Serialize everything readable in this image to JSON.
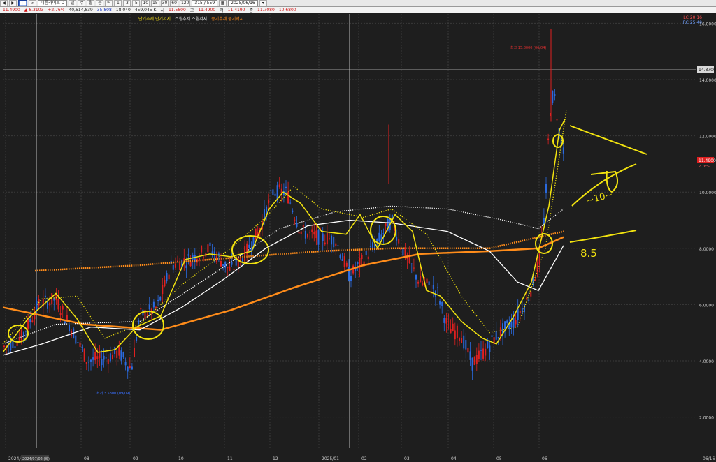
{
  "toolbar": {
    "symbol": "이룸라이트 D",
    "ratio": "315 / 559",
    "date": "2025/06/16",
    "periods": [
      "일",
      "주",
      "월",
      "분",
      "틱",
      "1",
      "3",
      "5",
      "10",
      "15",
      "30",
      "60",
      "120"
    ]
  },
  "quote": {
    "price": "11.4900",
    "change": "▲ 8.3103",
    "change_pct": "+2.76%",
    "volume": "40,614,839",
    "ratio1": "35.808",
    "ratio2": "18.040",
    "amount": "459,045 K",
    "open_label": "시",
    "open": "11.5800",
    "high_label": "고",
    "high": "11.4900",
    "low_label": "저",
    "low": "11.4190",
    "close_label": "종",
    "close": "11.7080",
    "last": "10.6800"
  },
  "legend": [
    {
      "text": "단기추세  단기저지",
      "color": "#e6d21a"
    },
    {
      "text": "스윙추세  스윙저지",
      "color": "#e0e0e0"
    },
    {
      "text": "중기추세  중기저지",
      "color": "#ff8a1a"
    }
  ],
  "corner": {
    "line1": "LC:20.16",
    "line2": "RC:25.40"
  },
  "axis": {
    "y_ticks": [
      "16.0000",
      "14.0000",
      "12.0000",
      "10.0000",
      "8.0000",
      "6.0000",
      "4.0000",
      "2.0000"
    ],
    "y_values": [
      16,
      14,
      12,
      10,
      8,
      6,
      4,
      2
    ],
    "x_ticks": [
      "2024/06",
      "08",
      "09",
      "10",
      "11",
      "12",
      "2025/01",
      "02",
      "03",
      "04",
      "05",
      "06",
      "06/16"
    ],
    "ref_price_label": "14.8700",
    "current_price_label": "11.4900",
    "current_pct_label": "2.76%",
    "peak_label": "최고 15.8000 (06/04)",
    "low_label": "최저 3.5300 (09/09)",
    "cursor_date": "2024/07/02 (화)"
  },
  "colors": {
    "bg": "#1e1e1e",
    "grid": "#3a3a3a",
    "up": "#e02020",
    "down": "#2a6ae0",
    "yellow": "#f2e30f",
    "white": "#ffffff",
    "orange": "#ff8c1a"
  },
  "annotations": {
    "range_note": "~10~",
    "level_note": "8.5"
  }
}
